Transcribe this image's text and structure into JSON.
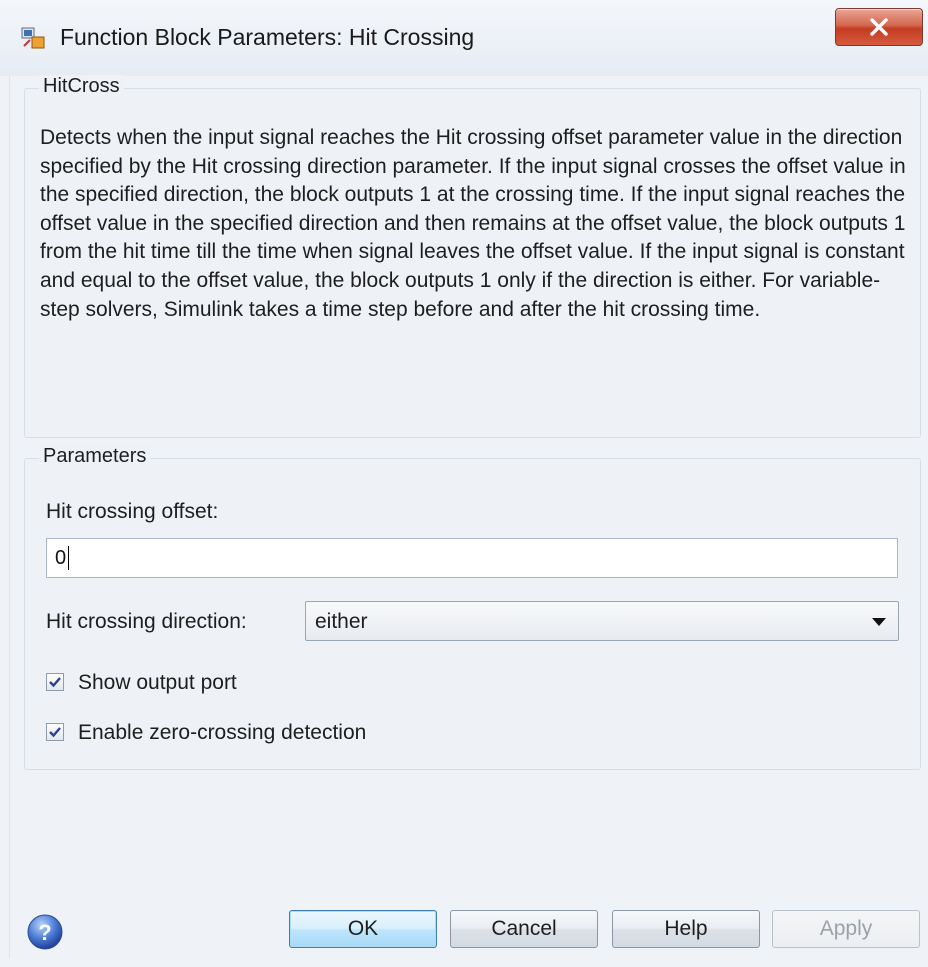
{
  "window": {
    "title": "Function Block Parameters: Hit Crossing"
  },
  "description_group": {
    "label": "HitCross",
    "text": "Detects when the input signal reaches the Hit crossing offset parameter value in the direction specified by the Hit crossing direction parameter. If the input signal crosses the offset value in the specified direction, the block outputs 1 at the crossing time. If the input signal reaches the offset value in the specified direction and then remains at the offset value, the block outputs 1 from the hit time till the time when signal leaves the offset value. If the input signal is constant and equal to the offset value, the block outputs 1 only if the direction is either. For variable-step solvers, Simulink takes a time step before and after the hit crossing time."
  },
  "parameters_group": {
    "label": "Parameters",
    "offset_label": "Hit crossing offset:",
    "offset_value": "0",
    "direction_label": "Hit crossing direction:",
    "direction_value": "either",
    "show_output_port_label": "Show output port",
    "show_output_port_checked": true,
    "zero_crossing_label": "Enable zero-crossing detection",
    "zero_crossing_checked": true
  },
  "buttons": {
    "ok": "OK",
    "cancel": "Cancel",
    "help": "Help",
    "apply": "Apply"
  },
  "icons": {
    "app": "simulink-block-icon",
    "close": "close-icon",
    "help": "help-icon",
    "dropdown": "chevron-down-icon"
  },
  "colors": {
    "close_button": "#c43c22",
    "default_button_border": "#3c7fb1",
    "window_bg": "#eff3f8"
  }
}
